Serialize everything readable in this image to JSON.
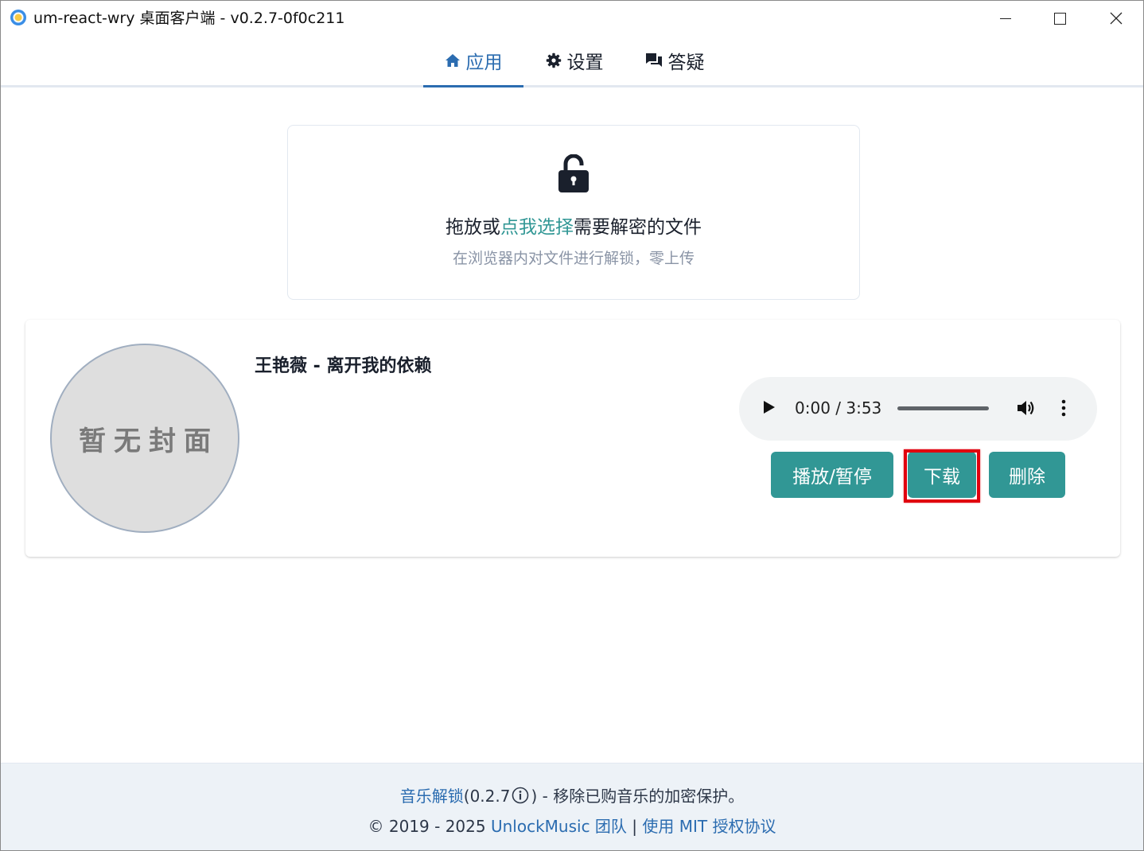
{
  "window": {
    "title": "um-react-wry 桌面客户端 - v0.2.7-0f0c211"
  },
  "tabs": [
    {
      "label": "应用",
      "icon": "home-icon",
      "active": true
    },
    {
      "label": "设置",
      "icon": "gear-icon",
      "active": false
    },
    {
      "label": "答疑",
      "icon": "chat-icon",
      "active": false
    }
  ],
  "dropzone": {
    "icon": "unlock-icon",
    "text_before": "拖放或",
    "link_text": "点我选择",
    "text_after": "需要解密的文件",
    "subtitle": "在浏览器内对文件进行解锁，零上传"
  },
  "file_card": {
    "cover_placeholder": "暂无封面",
    "song_title": "王艳薇 - 离开我的依赖",
    "player": {
      "time": "0:00 / 3:53",
      "progress": 0
    },
    "buttons": {
      "play_pause": "播放/暂停",
      "download": "下载",
      "delete": "删除"
    }
  },
  "footer": {
    "app_link": "音乐解锁",
    "version": "(0.2.7",
    "version_close": ") - 移除已购音乐的加密保护。",
    "copyright": "© 2019 - 2025",
    "team_link": "UnlockMusic 团队",
    "separator": "|",
    "license_link": "使用 MIT 授权协议"
  },
  "colors": {
    "accent": "#319795",
    "tab_active": "#2b6cb0",
    "highlight": "#e0000e",
    "footer_bg": "#edf2f7"
  }
}
